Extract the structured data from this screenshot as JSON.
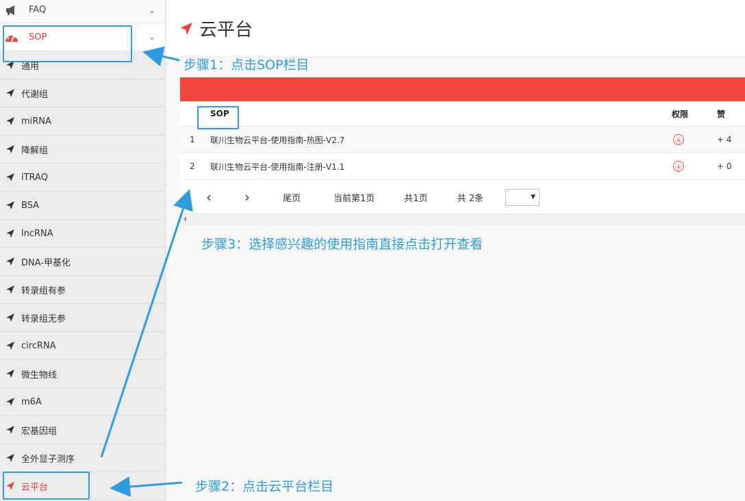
{
  "sidebar": {
    "faq": {
      "label": "FAQ",
      "icon": "megaphone-icon"
    },
    "sop": {
      "label": "SOP",
      "icon": "dashboard-icon"
    },
    "items": [
      {
        "label": "通用"
      },
      {
        "label": "代谢组"
      },
      {
        "label": "miRNA"
      },
      {
        "label": "降解组"
      },
      {
        "label": "iTRAQ"
      },
      {
        "label": "BSA"
      },
      {
        "label": "lncRNA"
      },
      {
        "label": "DNA-甲基化"
      },
      {
        "label": "转录组有参"
      },
      {
        "label": "转录组无参"
      },
      {
        "label": "circRNA"
      },
      {
        "label": "微生物线"
      },
      {
        "label": "m6A"
      },
      {
        "label": "宏基因组"
      },
      {
        "label": "全外显子测序"
      },
      {
        "label": "云平台"
      }
    ]
  },
  "header": {
    "title": "云平台"
  },
  "table": {
    "headers": {
      "name": "SOP",
      "perm": "权限",
      "like": "赞"
    },
    "rows": [
      {
        "num": "1",
        "name": "联川生物云平台-使用指南-热图-V2.7",
        "perm": "Ⓐ",
        "like": "+ 4"
      },
      {
        "num": "2",
        "name": "联川生物云平台-使用指南-注册-V1.1",
        "perm": "Ⓐ",
        "like": "+ 0"
      }
    ]
  },
  "pager": {
    "prev": "‹",
    "next": "›",
    "last": "尾页",
    "current": "当前第1页",
    "total_pages": "共1页",
    "total_items": "共 2条"
  },
  "annotations": {
    "step1": "步骤1：点击SOP栏目",
    "step2": "步骤2：点击云平台栏目",
    "step3": "步骤3：选择感兴趣的使用指南直接点击打开查看"
  },
  "colors": {
    "accent": "#ee3f3f",
    "redbar": "#f1453d",
    "annotation": "#2f9ce0"
  }
}
